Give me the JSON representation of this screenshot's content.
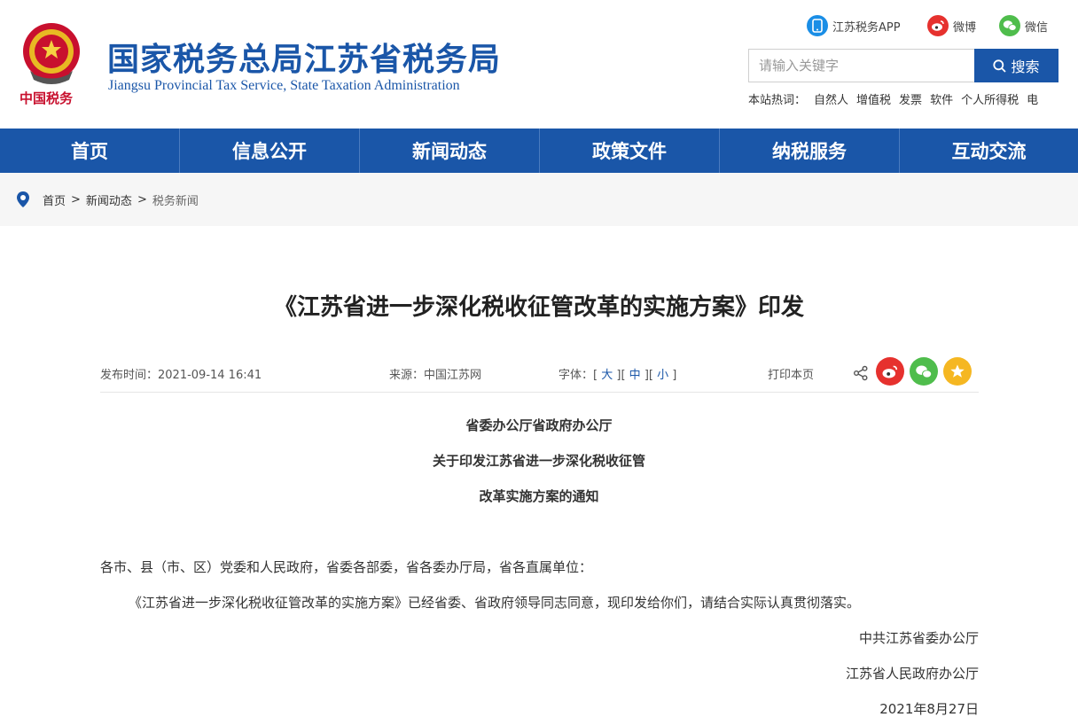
{
  "header": {
    "title": "国家税务总局江苏省税务局",
    "subtitle": "Jiangsu Provincial Tax Service, State Taxation Administration",
    "logo_text": "中国税务",
    "social": [
      {
        "label": "江苏税务APP",
        "icon": "phone-app-icon",
        "color": "#1a8ee6"
      },
      {
        "label": "微博",
        "icon": "weibo-icon",
        "color": "#e6312e"
      },
      {
        "label": "微信",
        "icon": "wechat-icon",
        "color": "#4fbd4c"
      }
    ],
    "search": {
      "placeholder": "请输入关键字",
      "button_label": "搜索"
    },
    "hotwords": {
      "label": "本站热词：",
      "items": [
        "自然人",
        "增值税",
        "发票",
        "软件",
        "个人所得税",
        "电"
      ]
    }
  },
  "nav": {
    "items": [
      "首页",
      "信息公开",
      "新闻动态",
      "政策文件",
      "纳税服务",
      "互动交流"
    ]
  },
  "breadcrumb": {
    "items": [
      "首页",
      "新闻动态",
      "税务新闻"
    ],
    "separator": ">"
  },
  "article": {
    "title": "《江苏省进一步深化税收征管改革的实施方案》印发",
    "meta": {
      "publish_time": "发布时间：2021-09-14 16:41",
      "source": "来源：中国江苏网",
      "font_label": "字体：",
      "font_sizes": [
        "大",
        "中",
        "小"
      ],
      "print": "打印本页"
    },
    "heading_lines": [
      "省委办公厅省政府办公厅",
      "关于印发江苏省进一步深化税收征管",
      "改革实施方案的通知"
    ],
    "paragraphs": [
      "各市、县（市、区）党委和人民政府，省委各部委，省各委办厅局，省各直属单位：",
      "《江苏省进一步深化税收征管改革的实施方案》已经省委、省政府领导同志同意，现印发给你们，请结合实际认真贯彻落实。"
    ],
    "signatures": [
      "中共江苏省委办公厅",
      "江苏省人民政府办公厅",
      "2021年8月27日"
    ]
  },
  "colors": {
    "brand": "#1a56a8",
    "nav_bg": "#1a56a8",
    "breadcrumb_bg": "#f6f6f6"
  }
}
